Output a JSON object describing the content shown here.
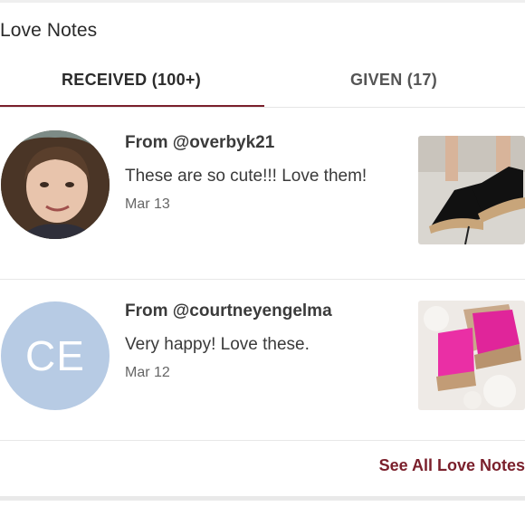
{
  "section": {
    "title": "Love Notes"
  },
  "tabs": [
    {
      "label": "RECEIVED (100+)",
      "active": true
    },
    {
      "label": "GIVEN (17)",
      "active": false
    }
  ],
  "notes": [
    {
      "from": "From @overbyk21",
      "message": "These are so cute!!! Love them!",
      "date": "Mar 13",
      "avatar": "user-photo",
      "thumbnail": "black-platform-sandal-photo"
    },
    {
      "from": "From @courtneyengelma",
      "message": "Very happy! Love these.",
      "date": "Mar 12",
      "avatar_initials": "CE",
      "thumbnail": "pink-platform-sandal-photo"
    }
  ],
  "footer": {
    "see_all_label": "See All Love Notes"
  },
  "colors": {
    "accent": "#7a1f2b",
    "avatar_placeholder": "#b7cbe4"
  }
}
